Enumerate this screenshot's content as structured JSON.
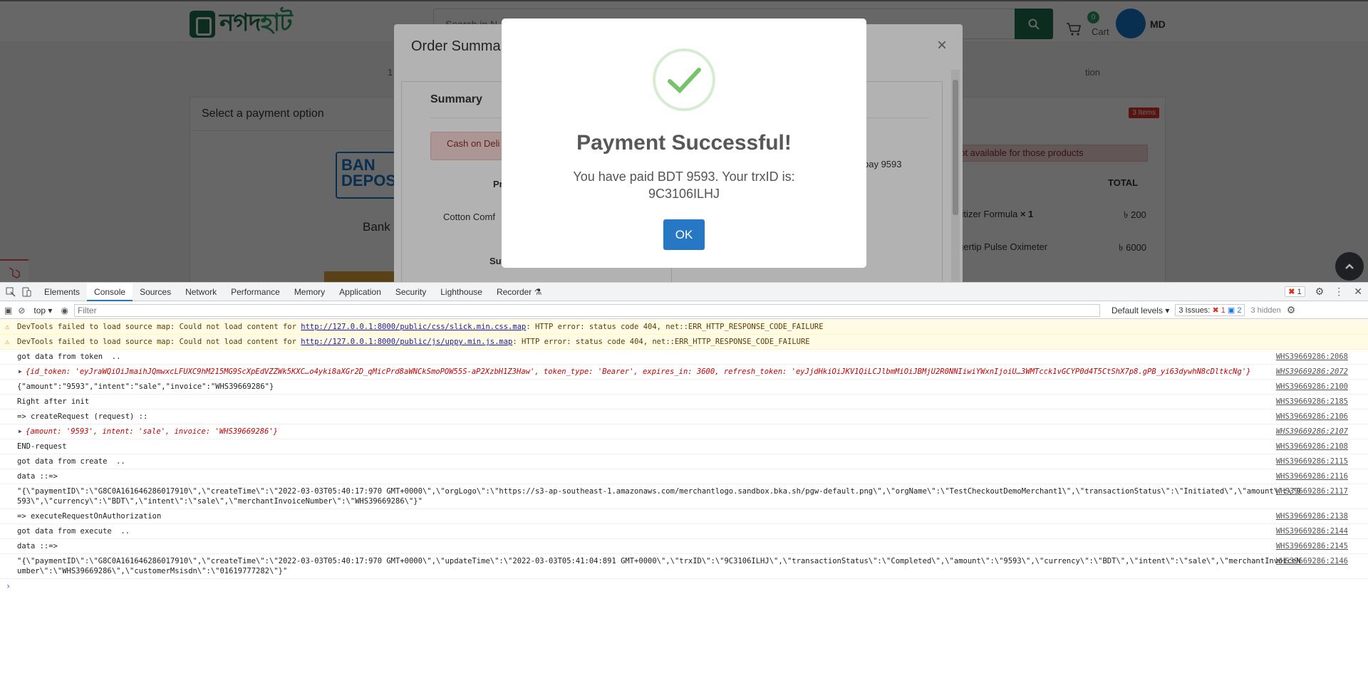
{
  "site": {
    "logo_text_main": "নগদ",
    "logo_text_tail": "হাট",
    "search_placeholder": "Search in N...",
    "cart_count": "0",
    "cart_label": "Cart",
    "avatar_initials": "MD",
    "steps": [
      "1",
      "tion"
    ]
  },
  "payment_card": {
    "title": "Select a payment option",
    "bank_logo_text": "BAN DEPOS",
    "bank_label": "Bank"
  },
  "cart_card": {
    "items_badge": "3 Items",
    "alert": "not available for those products",
    "total_header": "TOTAL",
    "rows": [
      {
        "name": "anitizer Formula",
        "qty": "× 1",
        "price": "৳ 200"
      },
      {
        "name": "ingertip Pulse Oximeter",
        "price": "৳ 6000"
      }
    ]
  },
  "order_modal": {
    "title": "Order Summa",
    "close": "×",
    "summary_heading": "Summary",
    "cod_alert": "Cash on Deli",
    "product_header": "Pr",
    "product_row": "Cotton Comf",
    "subtotal_header": "Sub",
    "pay_text": "pay 9593"
  },
  "success_modal": {
    "title": "Payment Successful!",
    "message_line1": "You have paid BDT 9593. Your trxID is:",
    "message_line2": "9C3106ILHJ",
    "ok_label": "OK"
  },
  "devtools": {
    "tabs": [
      "Elements",
      "Console",
      "Sources",
      "Network",
      "Performance",
      "Memory",
      "Application",
      "Security",
      "Lighthouse",
      "Recorder"
    ],
    "active_tab": "Console",
    "error_count": "1",
    "context": "top",
    "filter_placeholder": "Filter",
    "levels": "Default levels",
    "issues_label": "3 Issues:",
    "issues_red": "1",
    "issues_blue": "2",
    "hidden": "3 hidden",
    "logs": [
      {
        "type": "warn",
        "text": "DevTools failed to load source map: Could not load content for ",
        "link": "http://127.0.0.1:8000/public/css/slick.min.css.map",
        "tail": ": HTTP error: status code 404, net::ERR_HTTP_RESPONSE_CODE_FAILURE",
        "src": ""
      },
      {
        "type": "warn",
        "text": "DevTools failed to load source map: Could not load content for ",
        "link": "http://127.0.0.1:8000/public/js/uppy.min.js.map",
        "tail": ": HTTP error: status code 404, net::ERR_HTTP_RESPONSE_CODE_FAILURE",
        "src": ""
      },
      {
        "type": "log",
        "text": "got data from token  ..",
        "src": "WHS39669286:2068"
      },
      {
        "type": "obj",
        "text": "{id_token: 'eyJraWQiOiJmaihJQmwxcLFUXC9hM215MG9ScXpEdVZZWk5KXC…o4yki8aXGr2D_qMicPrd8aWNCkSmoPOW55S-aP2XzbH1Z3Haw', token_type: 'Bearer', expires_in: 3600, refresh_token: 'eyJjdHkiOiJKV1QiLCJlbmMiOiJBMjU2R0NNIiwiYWxnIjoiU…3WMTcck1vGCYP0d4T5CtShX7p8.gPB_yi63dywhN8cDltkcNg'}",
        "src": "WHS39669286:2072"
      },
      {
        "type": "log",
        "text": "{\"amount\":\"9593\",\"intent\":\"sale\",\"invoice\":\"WHS39669286\"}",
        "src": "WHS39669286:2100"
      },
      {
        "type": "log",
        "text": "Right after init",
        "src": "WHS39669286:2185"
      },
      {
        "type": "log",
        "text": "=> createRequest (request) ::",
        "src": "WHS39669286:2106"
      },
      {
        "type": "obj",
        "text": "{amount: '9593', intent: 'sale', invoice: 'WHS39669286'}",
        "src": "WHS39669286:2107"
      },
      {
        "type": "log",
        "text": "END-request",
        "src": "WHS39669286:2108"
      },
      {
        "type": "log",
        "text": "got data from create  ..",
        "src": "WHS39669286:2115"
      },
      {
        "type": "log",
        "text": "data ::=>",
        "src": "WHS39669286:2116"
      },
      {
        "type": "log",
        "text": "\"{\\\"paymentID\\\":\\\"G8C0A161646286017910\\\",\\\"createTime\\\":\\\"2022-03-03T05:40:17:970 GMT+0000\\\",\\\"orgLogo\\\":\\\"https://s3-ap-southeast-1.amazonaws.com/merchantlogo.sandbox.bka.sh/pgw-default.png\\\",\\\"orgName\\\":\\\"TestCheckoutDemoMerchant1\\\",\\\"transactionStatus\\\":\\\"Initiated\\\",\\\"amount\\\":\\\"9593\\\",\\\"currency\\\":\\\"BDT\\\",\\\"intent\\\":\\\"sale\\\",\\\"merchantInvoiceNumber\\\":\\\"WHS39669286\\\"}\"",
        "src": "WHS39669286:2117"
      },
      {
        "type": "log",
        "text": "=> executeRequestOnAuthorization",
        "src": "WHS39669286:2138"
      },
      {
        "type": "log",
        "text": "got data from execute  ..",
        "src": "WHS39669286:2144"
      },
      {
        "type": "log",
        "text": "data ::=>",
        "src": "WHS39669286:2145"
      },
      {
        "type": "log",
        "text": "\"{\\\"paymentID\\\":\\\"G8C0A161646286017910\\\",\\\"createTime\\\":\\\"2022-03-03T05:40:17:970 GMT+0000\\\",\\\"updateTime\\\":\\\"2022-03-03T05:41:04:891 GMT+0000\\\",\\\"trxID\\\":\\\"9C3106ILHJ\\\",\\\"transactionStatus\\\":\\\"Completed\\\",\\\"amount\\\":\\\"9593\\\",\\\"currency\\\":\\\"BDT\\\",\\\"intent\\\":\\\"sale\\\",\\\"merchantInvoiceNumber\\\":\\\"WHS39669286\\\",\\\"customerMsisdn\\\":\\\"01619777282\\\"}\"",
        "src": "WHS39669286:2146"
      }
    ],
    "prompt": "›"
  },
  "colors": {
    "brand_green": "#1e6d4c",
    "success_check": "#76c46a",
    "ok_button": "#2778c4",
    "devtools_active": "#1a73e8"
  }
}
